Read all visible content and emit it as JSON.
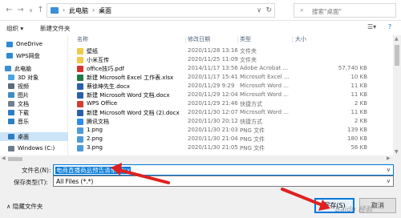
{
  "address": {
    "segments": [
      "此电脑",
      "桌面"
    ],
    "search_placeholder": "搜索\"桌面\""
  },
  "toolbar": {
    "organize": "组织 ▾",
    "new_folder": "新建文件夹"
  },
  "sidebar": [
    {
      "label": "OneDrive",
      "icon": "cloud-icon",
      "color": "#2a8ad4"
    },
    {
      "label": "WPS网盘",
      "icon": "cloud-icon",
      "color": "#2a8ad4"
    },
    {
      "label": "此电脑",
      "icon": "computer-icon",
      "color": "#3a8fd6"
    },
    {
      "label": "3D 对象",
      "icon": "cube-icon",
      "color": "#4aa3df"
    },
    {
      "label": "视频",
      "icon": "video-icon",
      "color": "#5d6b7a"
    },
    {
      "label": "图片",
      "icon": "picture-icon",
      "color": "#3f8ec2"
    },
    {
      "label": "文档",
      "icon": "document-icon",
      "color": "#6f7f8f"
    },
    {
      "label": "下载",
      "icon": "download-icon",
      "color": "#2d7fc1"
    },
    {
      "label": "音乐",
      "icon": "music-icon",
      "color": "#2d7fc1"
    },
    {
      "label": "桌面",
      "icon": "desktop-icon",
      "color": "#2d7fc1",
      "selected": true
    },
    {
      "label": "Windows (C:)",
      "icon": "drive-icon",
      "color": "#6d7b88"
    }
  ],
  "columns": {
    "name": "名称",
    "date": "修改日期",
    "type": "类型",
    "size": "大小"
  },
  "files": [
    {
      "name": "壁纸",
      "date": "2020/11/28 13:16",
      "type": "文件夹",
      "size": "",
      "icon": "folder-icon",
      "color": "#f2c94c"
    },
    {
      "name": "小米互传",
      "date": "2020/11/25 11:09",
      "type": "文件夹",
      "size": "",
      "icon": "folder-icon",
      "color": "#f2c94c"
    },
    {
      "name": "office技巧.pdf",
      "date": "2014/11/17 13:56",
      "type": "Adobe Acrobat ...",
      "size": "57,740 KB",
      "icon": "pdf-icon",
      "color": "#d9322b"
    },
    {
      "name": "新建 Microsoft Excel 工作表.xlsx",
      "date": "2020/11/17 15:41",
      "type": "Microsoft Excel ...",
      "size": "10 KB",
      "icon": "excel-icon",
      "color": "#1f7a43"
    },
    {
      "name": "蔡徐坤先生.docx",
      "date": "2020/11/29 9:29",
      "type": "Microsoft Word ...",
      "size": "11 KB",
      "icon": "word-icon",
      "color": "#2b5fad"
    },
    {
      "name": "新建 Microsoft Word 文档.docx",
      "date": "2020/11/29 12:04",
      "type": "Microsoft Word ...",
      "size": "11 KB",
      "icon": "word-icon",
      "color": "#2b5fad"
    },
    {
      "name": "WPS Office",
      "date": "2020/11/29 21:46",
      "type": "快捷方式",
      "size": "2 KB",
      "icon": "wps-icon",
      "color": "#d63b2f"
    },
    {
      "name": "新建 Microsoft Word 文档 (2).docx",
      "date": "2020/11/30 12:07",
      "type": "Microsoft Word ...",
      "size": "11 KB",
      "icon": "word-icon",
      "color": "#2b5fad"
    },
    {
      "name": "腾讯文档",
      "date": "2020/11/30 20:12",
      "type": "快捷方式",
      "size": "2 KB",
      "icon": "shortcut-icon",
      "color": "#2d8cf0"
    },
    {
      "name": "1.png",
      "date": "2020/11/30 21:03",
      "type": "PNG 文件",
      "size": "139 KB",
      "icon": "image-icon",
      "color": "#4f9bd9"
    },
    {
      "name": "2.png",
      "date": "2020/11/30 21:04",
      "type": "PNG 文件",
      "size": "180 KB",
      "icon": "image-icon",
      "color": "#4f9bd9"
    },
    {
      "name": "3.png",
      "date": "2020/11/30 21:05",
      "type": "PNG 文件",
      "size": "56 KB",
      "icon": "image-icon",
      "color": "#4f9bd9"
    }
  ],
  "form": {
    "filename_label": "文件名(N):",
    "filename_value": "电商直播商品预告清单.xlsx",
    "filetype_label": "保存类型(T):",
    "filetype_value": "All Files (*.*)",
    "hide_folders": "隐藏文件夹",
    "save": "保存(S)",
    "cancel": "取消"
  },
  "watermark": "Baidu 经验",
  "colors": {
    "accent": "#0078d7",
    "arrow": "#e02020",
    "selection": "#cce4f7"
  }
}
